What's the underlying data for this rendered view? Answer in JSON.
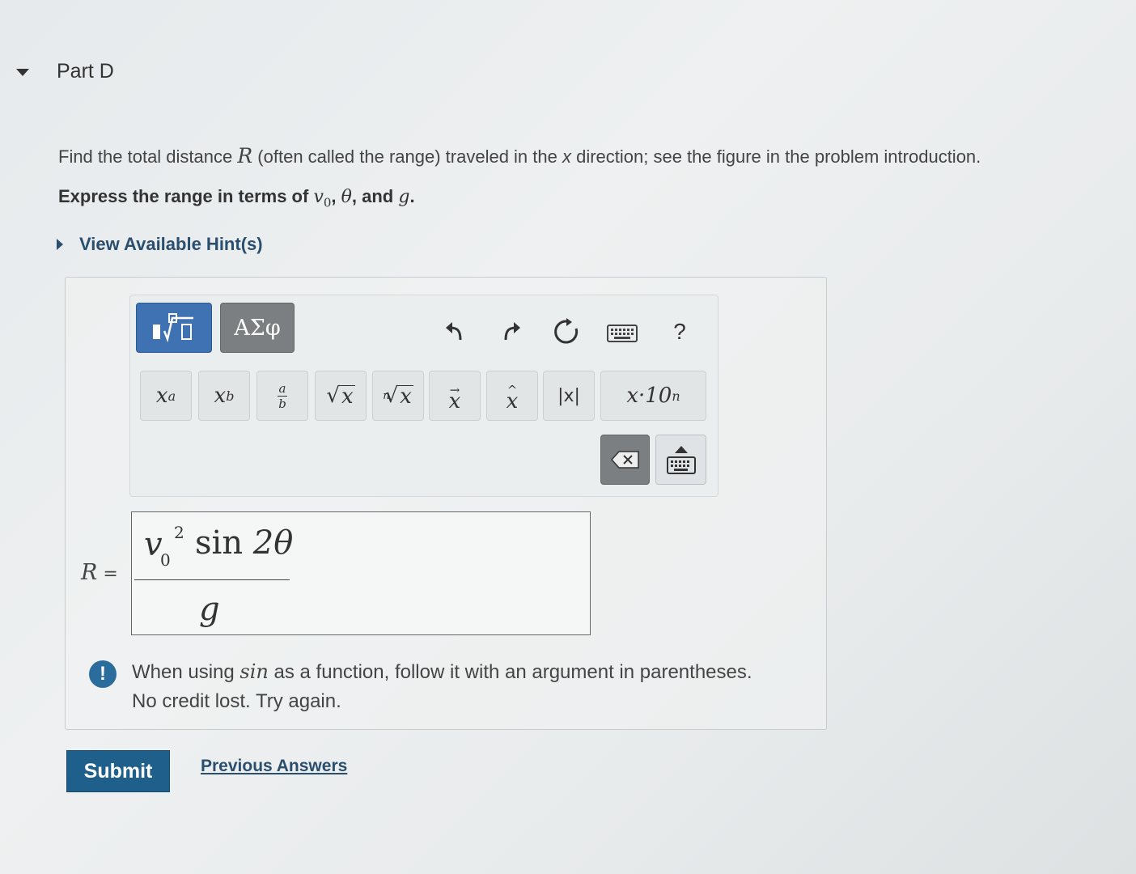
{
  "part": {
    "title": "Part D"
  },
  "question": {
    "prefix": "Find the total distance ",
    "var_r": "R",
    "middle": " (often called the range) traveled in the ",
    "var_x": "x",
    "suffix": " direction; see the figure in the problem introduction."
  },
  "express": {
    "prefix": "Express the range in terms of ",
    "v0": "v",
    "v0_sub": "0",
    "sep1": ", ",
    "theta": "θ",
    "sep2": ", and ",
    "g": "g",
    "end": "."
  },
  "hint": {
    "label": "View Available Hint(s)"
  },
  "toolbar": {
    "greek_label": "ΑΣφ",
    "help_label": "?",
    "keys": {
      "sup_base": "x",
      "sup_exp": "a",
      "sub_base": "x",
      "sub_idx": "b",
      "frac_num": "a",
      "frac_den": "b",
      "sqrt_rad": "x",
      "nroot_idx": "n",
      "nroot_rad": "x",
      "vec": "x",
      "hat": "x",
      "abs": "|x|",
      "sci_base": "x·10",
      "sci_exp": "n"
    }
  },
  "answer": {
    "label_var": "R",
    "label_eq": " =",
    "num_v": "v",
    "num_sub": "0",
    "num_sup": "2",
    "num_fn": "sin",
    "num_arg": " 2θ",
    "den": "g"
  },
  "feedback": {
    "icon": "!",
    "line1_prefix": "When using ",
    "line1_fn": "sin",
    "line1_suffix": " as a function, follow it with an argument in parentheses.",
    "line2": "No credit lost. Try again."
  },
  "actions": {
    "submit_label": "Submit",
    "previous_label": "Previous Answers"
  },
  "colors": {
    "accent": "#1f5f8b",
    "template_btn": "#3f72b3",
    "greek_btn": "#7b7f82",
    "link": "#2a4e6e"
  }
}
